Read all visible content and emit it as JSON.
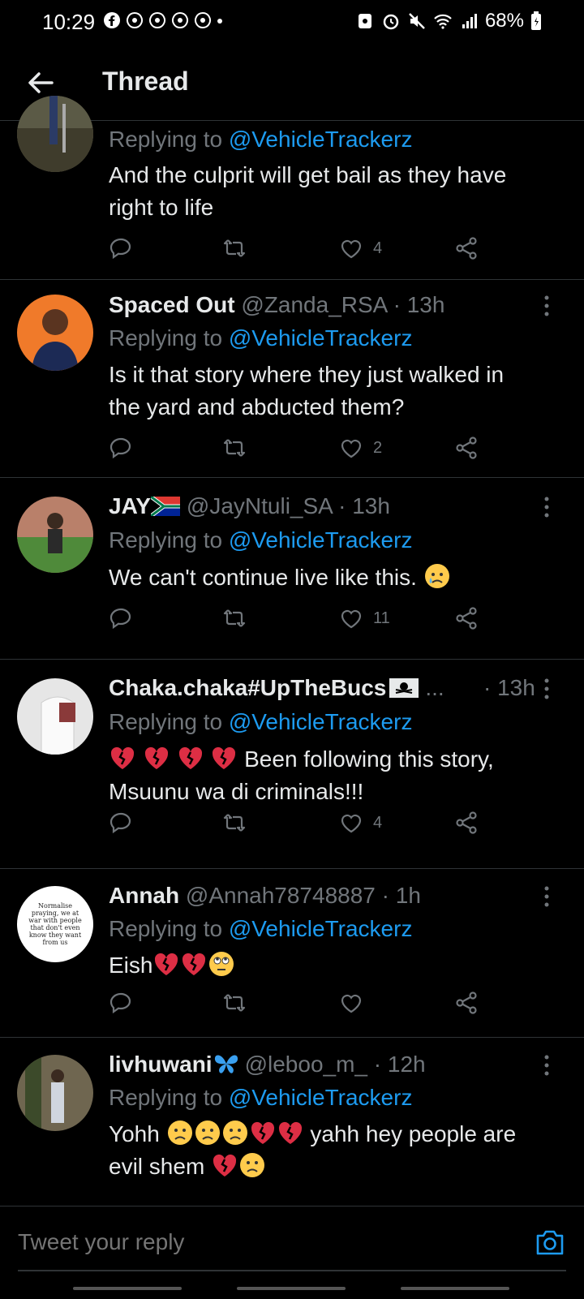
{
  "status_bar": {
    "time": "10:29",
    "battery": "68%"
  },
  "header": {
    "title": "Thread"
  },
  "compose": {
    "placeholder": "Tweet your reply"
  },
  "tweets": [
    {
      "replying_prefix": "Replying to ",
      "replying_handle": "@VehicleTrackerz",
      "lines": [
        "And the culprit will get bail as they have",
        "right to life"
      ],
      "likes": "4"
    },
    {
      "name": "Spaced Out",
      "handle": "@Zanda_RSA",
      "sep": " · ",
      "time": "13h",
      "replying_prefix": "Replying to ",
      "replying_handle": "@VehicleTrackerz",
      "lines": [
        "Is it that story where they just walked in",
        "the yard and abducted them?"
      ],
      "likes": "2"
    },
    {
      "name": "JAY",
      "handle": "@JayNtuli_SA",
      "sep": " · ",
      "time": "13h",
      "replying_prefix": "Replying to ",
      "replying_handle": "@VehicleTrackerz",
      "text": "We can't continue live like this.",
      "likes": "11"
    },
    {
      "name": "Chaka.chaka#UpTheBucs",
      "ellipsis": "...",
      "sep": "· ",
      "time": "13h",
      "replying_prefix": "Replying to ",
      "replying_handle": "@VehicleTrackerz",
      "text_after_emoji": "Been following this story,",
      "line2": "Msuunu wa di criminals!!!",
      "likes": "4"
    },
    {
      "name": "Annah",
      "handle": "@Annah78748887",
      "sep": " · ",
      "time": "1h",
      "avatar_text": "Normalise praying, we at war with people that don't even know they want from us",
      "replying_prefix": "Replying to ",
      "replying_handle": "@VehicleTrackerz",
      "text": "Eish",
      "likes": ""
    },
    {
      "name": "livhuwani",
      "handle": "@leboo_m_",
      "sep": " · ",
      "time": "12h",
      "replying_prefix": "Replying to ",
      "replying_handle": "@VehicleTrackerz",
      "text_start": "Yohh",
      "text_mid": "yahh hey people are",
      "text_line2": "evil shem"
    }
  ],
  "colors": {
    "link": "#1d9bf0",
    "muted": "#71767b",
    "divider": "#2f3336"
  }
}
